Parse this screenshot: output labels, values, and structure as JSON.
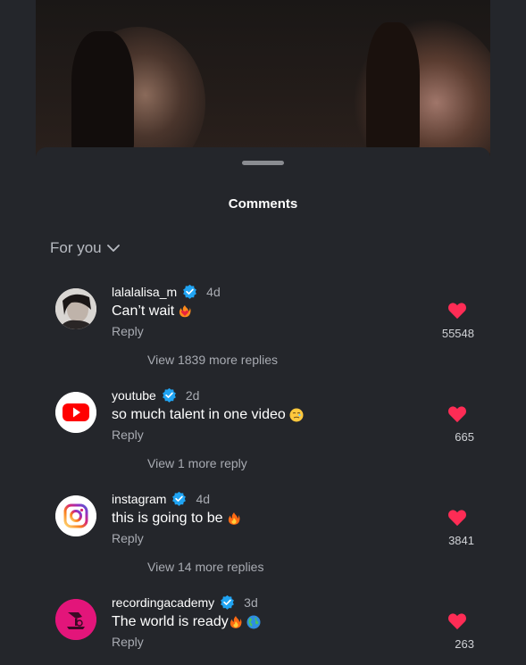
{
  "sheet": {
    "title": "Comments"
  },
  "filter": {
    "label": "For you"
  },
  "comments": [
    {
      "username": "lalalalisa_m",
      "age": "4d",
      "text": "Can’t wait",
      "reply_label": "Reply",
      "likes": "55548",
      "view_more": "View 1839 more replies"
    },
    {
      "username": "youtube",
      "age": "2d",
      "text": "so much talent in one video",
      "reply_label": "Reply",
      "likes": "665",
      "view_more": "View 1 more reply"
    },
    {
      "username": "instagram",
      "age": "4d",
      "text": "this is going to be",
      "reply_label": "Reply",
      "likes": "3841",
      "view_more": "View 14 more replies"
    },
    {
      "username": "recordingacademy",
      "age": "3d",
      "text": "The world is ready",
      "reply_label": "Reply",
      "likes": "263"
    }
  ],
  "colors": {
    "background": "#24262b",
    "heart": "#fe2c55",
    "verified": "#20a4f3",
    "muted_text": "#a8abb2"
  }
}
